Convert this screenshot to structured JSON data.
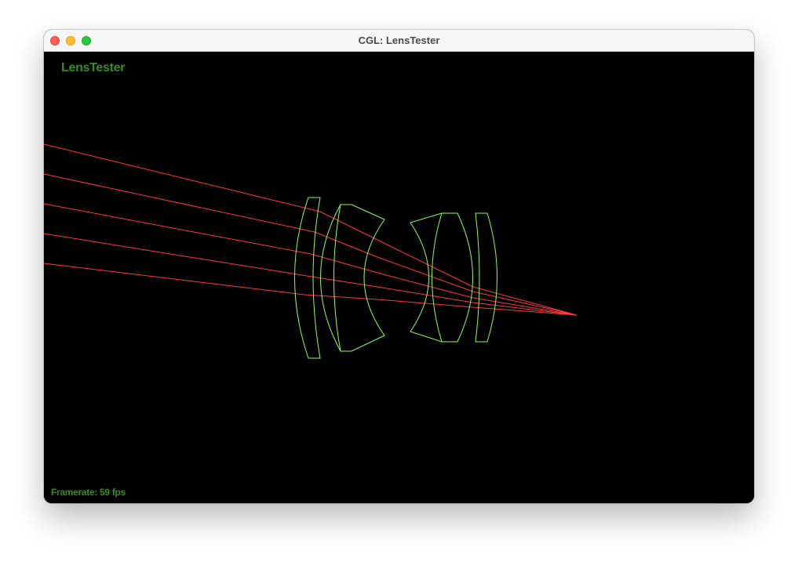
{
  "window": {
    "title": "CGL: LensTester"
  },
  "overlay": {
    "app_label": "LensTester",
    "framerate_text": "Framerate: 59 fps"
  },
  "colors": {
    "ray": "#ff3b3b",
    "lens": "#8dff5a",
    "label": "#3d8a2a",
    "background": "#000000"
  },
  "icons": [
    "close-icon",
    "minimize-icon",
    "zoom-icon"
  ]
}
